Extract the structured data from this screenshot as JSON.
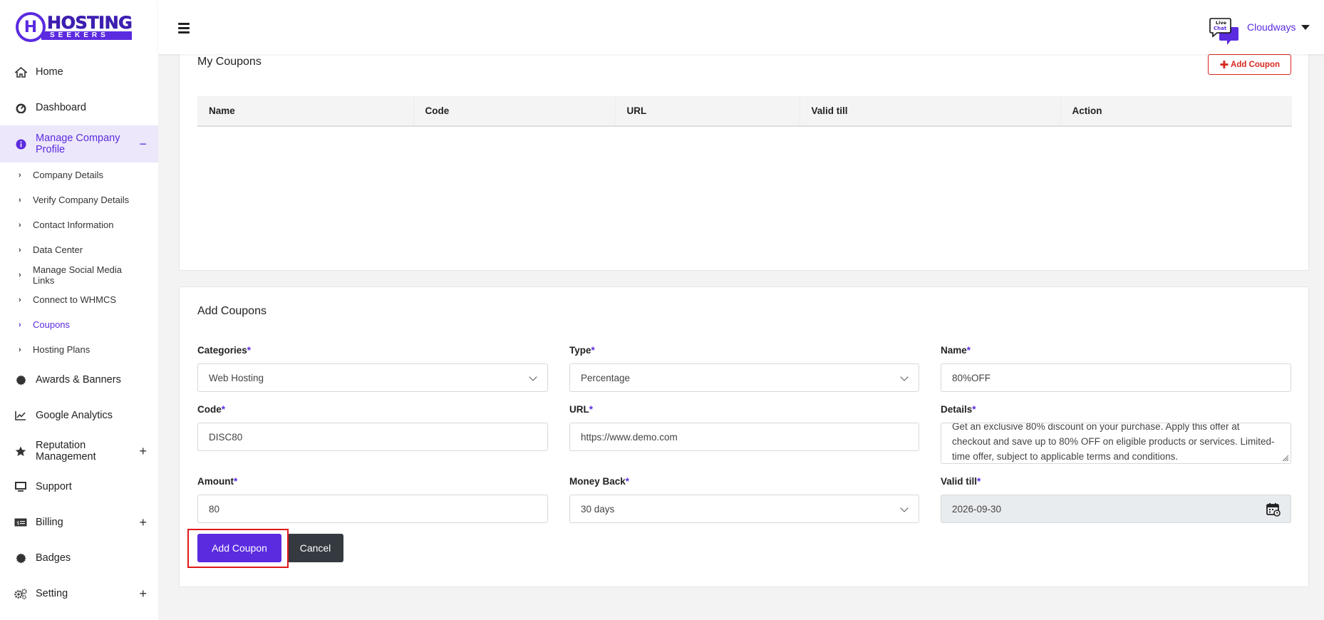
{
  "brand": {
    "top": "HOSTING",
    "bottom": "SEEKERS"
  },
  "sidebar": {
    "items": [
      {
        "label": "Home",
        "icon": "home-icon"
      },
      {
        "label": "Dashboard",
        "icon": "dashboard-gauge-icon"
      },
      {
        "label": "Manage Company Profile",
        "icon": "info-circle-icon",
        "toggle": "−"
      },
      {
        "label": "Awards & Banners",
        "icon": "badge-cog-icon"
      },
      {
        "label": "Google Analytics",
        "icon": "chart-line-icon"
      },
      {
        "label": "Reputation Management",
        "icon": "star-icon",
        "toggle": "+"
      },
      {
        "label": "Support",
        "icon": "monitor-icon"
      },
      {
        "label": "Billing",
        "icon": "money-bill-icon",
        "toggle": "+"
      },
      {
        "label": "Badges",
        "icon": "badge-icon"
      },
      {
        "label": "Setting",
        "icon": "gears-icon",
        "toggle": "+"
      }
    ],
    "subitems": [
      "Company Details",
      "Verify Company Details",
      "Contact Information",
      "Data Center",
      "Manage Social Media Links",
      "Connect to WHMCS",
      "Coupons",
      "Hosting Plans"
    ]
  },
  "topbar": {
    "live_chat_top": "Live",
    "live_chat_bottom": "Chat",
    "user_name": "Cloudways"
  },
  "my_coupons": {
    "title": "My Coupons",
    "add_button": "Add Coupon",
    "columns": [
      "Name",
      "Code",
      "URL",
      "Valid till",
      "Action"
    ]
  },
  "add_coupons": {
    "title": "Add Coupons",
    "required_mark": "*",
    "categories": {
      "label": "Categories",
      "value": "Web Hosting"
    },
    "type": {
      "label": "Type",
      "value": "Percentage"
    },
    "name": {
      "label": "Name",
      "value": "80%OFF"
    },
    "code": {
      "label": "Code",
      "value": "DISC80"
    },
    "url": {
      "label": "URL",
      "value": "https://www.demo.com"
    },
    "details": {
      "label": "Details",
      "value": "Get an exclusive 80% discount on your purchase. Apply this offer at checkout and save up to 80% OFF on eligible products or services. Limited-time offer, subject to applicable terms and conditions."
    },
    "amount": {
      "label": "Amount",
      "value": "80"
    },
    "money_back": {
      "label": "Money Back",
      "value": "30 days"
    },
    "valid_till": {
      "label": "Valid till",
      "value": "2026-09-30"
    },
    "submit_label": "Add Coupon",
    "cancel_label": "Cancel"
  },
  "colors": {
    "accent": "#5b2be0",
    "danger": "#d9281f",
    "dark_button": "#343a40",
    "highlight_box": "#e11818"
  }
}
